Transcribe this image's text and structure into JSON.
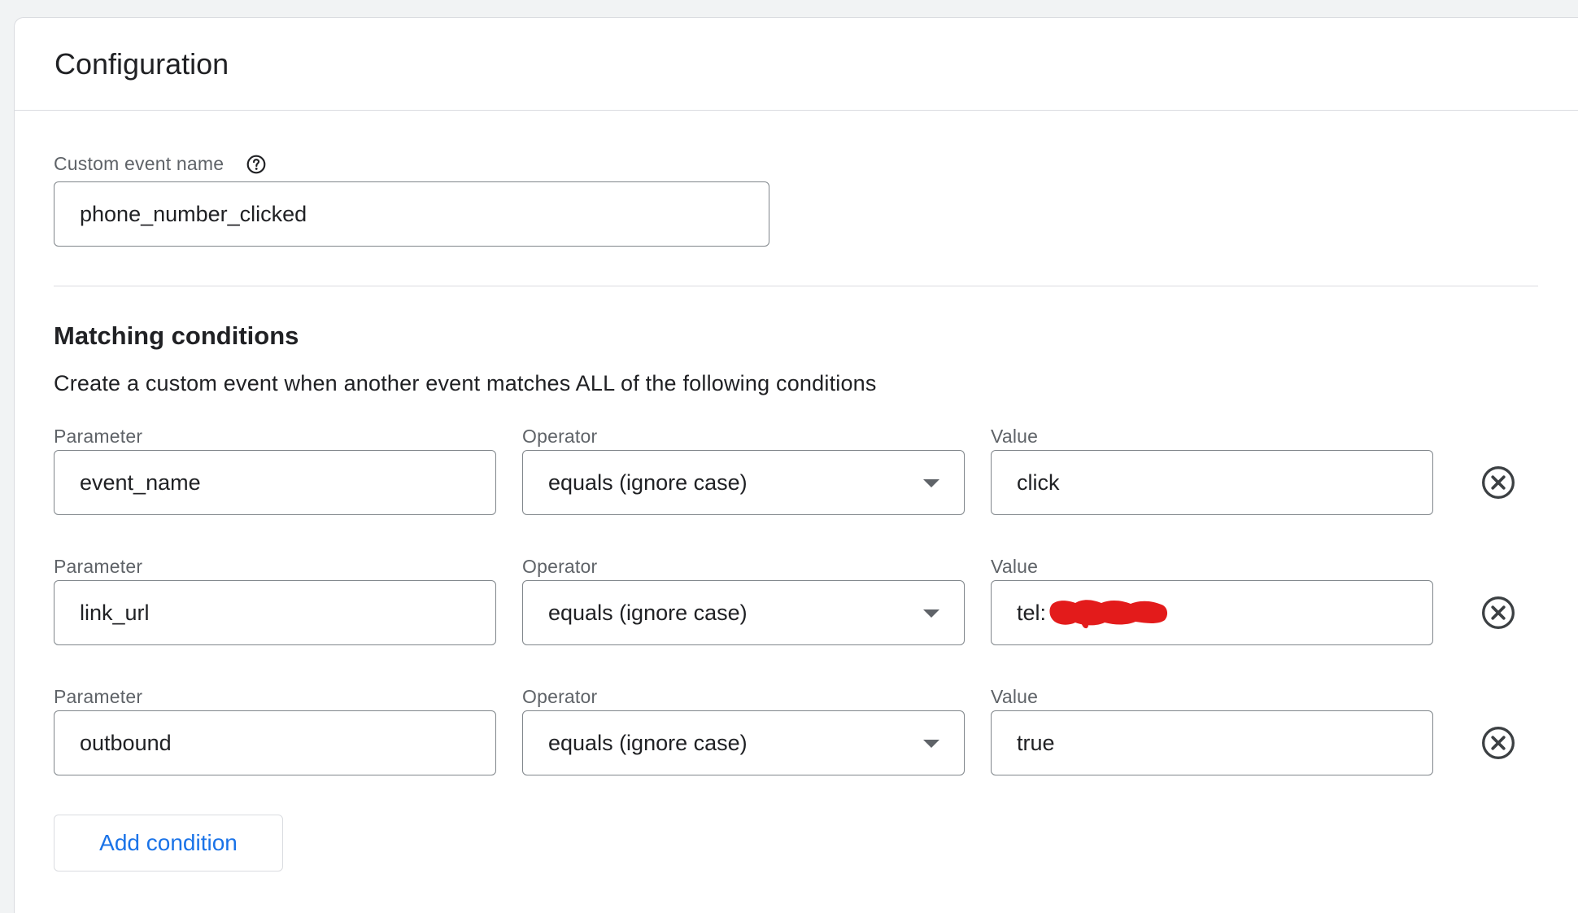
{
  "card": {
    "title": "Configuration"
  },
  "custom_event": {
    "label": "Custom event name",
    "value": "phone_number_clicked",
    "help_icon": "help-circle-icon"
  },
  "matching": {
    "title": "Matching conditions",
    "description": "Create a custom event when another event matches ALL of the following conditions"
  },
  "conditions": [
    {
      "parameter_label": "Parameter",
      "parameter": "event_name",
      "operator_label": "Operator",
      "operator": "equals (ignore case)",
      "value_label": "Value",
      "value": "click"
    },
    {
      "parameter_label": "Parameter",
      "parameter": "link_url",
      "operator_label": "Operator",
      "operator": "equals (ignore case)",
      "value_label": "Value",
      "value": "tel:"
    },
    {
      "parameter_label": "Parameter",
      "parameter": "outbound",
      "operator_label": "Operator",
      "operator": "equals (ignore case)",
      "value_label": "Value",
      "value": "true"
    }
  ],
  "add_condition_label": "Add condition",
  "colors": {
    "accent": "#1a73e8",
    "redaction": "#e31b1b",
    "border": "#80868b"
  }
}
